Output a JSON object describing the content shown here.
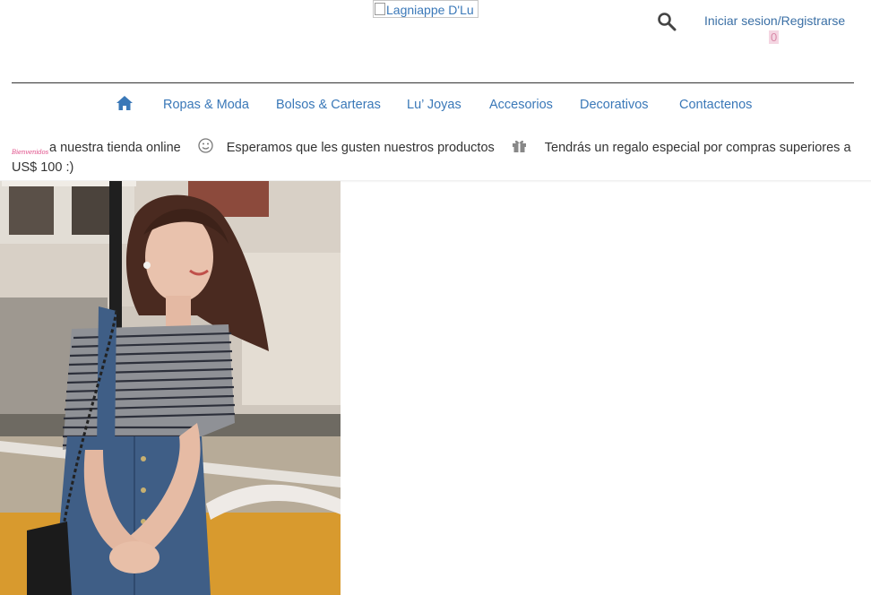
{
  "header": {
    "logo_alt": "Lagniappe D'Lu",
    "login_label": "Iniciar sesion/Registrarse",
    "cart_count": "0"
  },
  "nav": {
    "items": [
      {
        "label": "Ropas & Moda"
      },
      {
        "label": "Bolsos & Carteras"
      },
      {
        "label": "Lu’ Joyas"
      },
      {
        "label": "Accesorios"
      },
      {
        "label": "Decorativos"
      },
      {
        "label": "Contactenos"
      }
    ]
  },
  "marquee": {
    "welcome_image_text": "Bienvenidos",
    "part1": "a nuestra tienda online",
    "part2": "Esperamos que les gusten nuestros productos",
    "part3": "Tendrás un regalo especial por compras superiores a US$ 100 :)"
  },
  "colors": {
    "link": "#3a78b8",
    "accent_pink": "#e0508a"
  },
  "icons": [
    "search-icon",
    "home-icon",
    "smile-icon",
    "gift-icon"
  ]
}
